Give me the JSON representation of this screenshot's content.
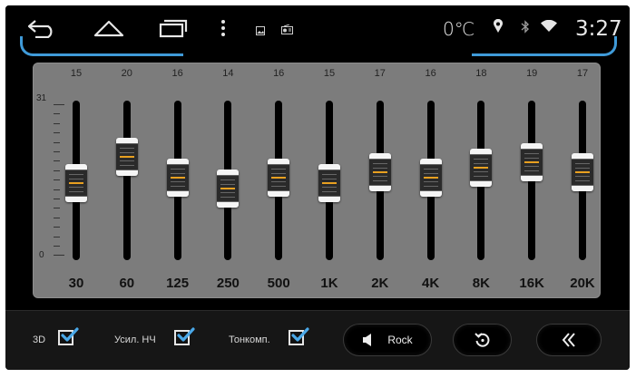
{
  "status_bar": {
    "temperature": "0℃",
    "time": "3:27"
  },
  "icons": {
    "back": "back-arrow-icon",
    "home": "home-icon",
    "recents": "recent-apps-icon",
    "menu": "more-vert-icon",
    "image": "image-icon",
    "radio": "radio-icon",
    "location": "location-pin-icon",
    "bluetooth": "bluetooth-icon",
    "wifi": "wifi-icon"
  },
  "equalizer": {
    "scale_max": "31",
    "scale_min": "0",
    "bands": [
      {
        "freq": "30",
        "value": "15",
        "level": 15
      },
      {
        "freq": "60",
        "value": "20",
        "level": 20
      },
      {
        "freq": "125",
        "value": "16",
        "level": 16
      },
      {
        "freq": "250",
        "value": "14",
        "level": 14
      },
      {
        "freq": "500",
        "value": "16",
        "level": 16
      },
      {
        "freq": "1K",
        "value": "15",
        "level": 15
      },
      {
        "freq": "2K",
        "value": "17",
        "level": 17
      },
      {
        "freq": "4K",
        "value": "16",
        "level": 16
      },
      {
        "freq": "8K",
        "value": "18",
        "level": 18
      },
      {
        "freq": "16K",
        "value": "19",
        "level": 19
      },
      {
        "freq": "20K",
        "value": "17",
        "level": 17
      }
    ]
  },
  "bottom_bar": {
    "checkbox_3d": {
      "label": "3D",
      "checked": true
    },
    "checkbox_bass": {
      "label": "Усил. НЧ",
      "checked": true
    },
    "checkbox_loudness": {
      "label": "Тонкомп.",
      "checked": true
    },
    "preset_label": "Rock"
  },
  "colors": {
    "accent": "#3f9ad8",
    "checkmark": "#4aa8e8",
    "panel": "#7c7c7c",
    "knob_marker": "#e8a020"
  }
}
